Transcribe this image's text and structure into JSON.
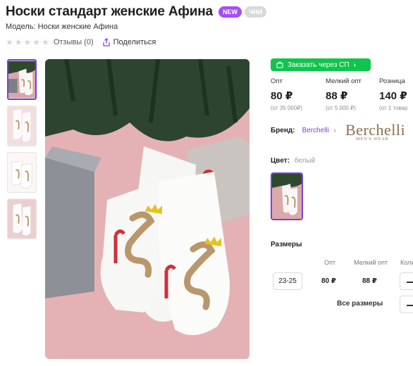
{
  "product": {
    "title": "Носки стандарт женские Афина",
    "badge_new": "NEW",
    "badge_2": "ЧНИ",
    "model": "Модель: Носки женские Афина"
  },
  "rating": {
    "stars": 0,
    "max_stars": 5,
    "reviews_label": "Отзывы (0)",
    "share_label": "Поделиться"
  },
  "gallery": {
    "thumbs": [
      "thumb-1",
      "thumb-2",
      "thumb-3",
      "thumb-4"
    ],
    "active_index": 0
  },
  "order": {
    "label": "Заказать через СП",
    "color": "#10c44c"
  },
  "prices": [
    {
      "label": "Опт",
      "value": "80 ₽",
      "min": "(от 35 000₽)"
    },
    {
      "label": "Мелкий опт",
      "value": "88 ₽",
      "min": "(от 5 000 ₽)"
    },
    {
      "label": "Розница",
      "value": "140 ₽",
      "min": "(от 1 товар"
    }
  ],
  "brand": {
    "key": "Бренд:",
    "value": "Berchelli",
    "logo_text": "Berchelli",
    "logo_sub": "MEN'S WEAR"
  },
  "color": {
    "key": "Цвет:",
    "value": "белый"
  },
  "sizes": {
    "title": "Размеры",
    "headers": [
      "Опт",
      "Мелкий опт",
      "Коли"
    ],
    "rows": [
      {
        "size": "23-25",
        "opt": "80 ₽",
        "small_opt": "88 ₽"
      }
    ],
    "all_sizes_label": "Все размеры"
  },
  "accent": "#7d3fd6"
}
